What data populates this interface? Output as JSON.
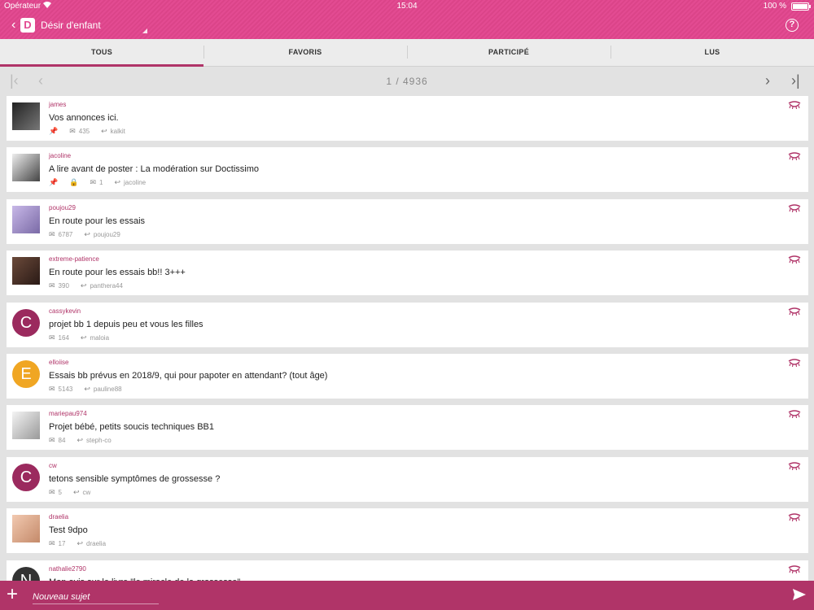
{
  "status_bar": {
    "carrier": "Opérateur",
    "time": "15:04",
    "battery": "100 %"
  },
  "header": {
    "back_glyph": "‹",
    "logo_letter": "D",
    "title": "Désir d'enfant",
    "help_glyph": "?"
  },
  "tabs": [
    {
      "label": "TOUS",
      "active": true
    },
    {
      "label": "FAVORIS",
      "active": false
    },
    {
      "label": "PARTICIPÉ",
      "active": false
    },
    {
      "label": "LUS",
      "active": false
    }
  ],
  "pager": {
    "label": "1 / 4936",
    "first_glyph": "|‹",
    "prev_glyph": "‹",
    "next_glyph": "›",
    "last_glyph": "›|"
  },
  "topics": [
    {
      "author": "james",
      "subject": "Vos annonces ici.",
      "pinned": true,
      "locked": false,
      "replies": "435",
      "last_poster": "kalkit",
      "avatar": {
        "type": "photo",
        "colors": [
          "#222",
          "#777"
        ]
      }
    },
    {
      "author": "jacoline",
      "subject": "A lire avant de poster : La modération sur Doctissimo",
      "pinned": true,
      "locked": true,
      "replies": "1",
      "last_poster": "jacoline",
      "avatar": {
        "type": "photo",
        "colors": [
          "#eee",
          "#444"
        ]
      }
    },
    {
      "author": "poujou29",
      "subject": "En route pour les essais",
      "pinned": false,
      "locked": false,
      "replies": "6787",
      "last_poster": "poujou29",
      "avatar": {
        "type": "photo",
        "colors": [
          "#c8b8e8",
          "#7a6aa6"
        ]
      }
    },
    {
      "author": "extreme-patience",
      "subject": "En route pour les essais bb!!  3+++",
      "pinned": false,
      "locked": false,
      "replies": "390",
      "last_poster": "panthera44",
      "avatar": {
        "type": "photo",
        "colors": [
          "#6b4a3a",
          "#2a1a16"
        ]
      }
    },
    {
      "author": "cassykevin",
      "subject": "projet bb 1 depuis peu et vous les filles",
      "pinned": false,
      "locked": false,
      "replies": "164",
      "last_poster": "maloia",
      "avatar": {
        "type": "letter",
        "letter": "C",
        "color": "#9b2a5e"
      }
    },
    {
      "author": "elloiise",
      "subject": "Essais bb prévus en 2018/9, qui pour papoter en attendant? (tout âge)",
      "pinned": false,
      "locked": false,
      "replies": "5143",
      "last_poster": "pauline88",
      "avatar": {
        "type": "letter",
        "letter": "E",
        "color": "#f0a623"
      }
    },
    {
      "author": "mariepau974",
      "subject": "Projet bébé, petits soucis techniques BB1",
      "pinned": false,
      "locked": false,
      "replies": "84",
      "last_poster": "steph-co",
      "avatar": {
        "type": "photo",
        "colors": [
          "#f4f4f4",
          "#999"
        ]
      }
    },
    {
      "author": "cw",
      "subject": "tetons sensible symptômes de grossesse ?",
      "pinned": false,
      "locked": false,
      "replies": "5",
      "last_poster": "cw",
      "avatar": {
        "type": "letter",
        "letter": "C",
        "color": "#9b2a5e"
      }
    },
    {
      "author": "draelia",
      "subject": "Test 9dpo",
      "pinned": false,
      "locked": false,
      "replies": "17",
      "last_poster": "draelia",
      "avatar": {
        "type": "photo",
        "colors": [
          "#f2c9b0",
          "#c48a6a"
        ]
      }
    },
    {
      "author": "nathalie2790",
      "subject": "Mon avis sur le livre \"le miracle de la grossesse\"",
      "pinned": false,
      "locked": false,
      "replies": "",
      "last_poster": "",
      "avatar": {
        "type": "letter",
        "letter": "N",
        "color": "#333333"
      }
    }
  ],
  "footer": {
    "plus_glyph": "+",
    "new_topic_placeholder": "Nouveau sujet"
  },
  "colors": {
    "brand_pink": "#e34b92",
    "brand_dark": "#b03468"
  }
}
